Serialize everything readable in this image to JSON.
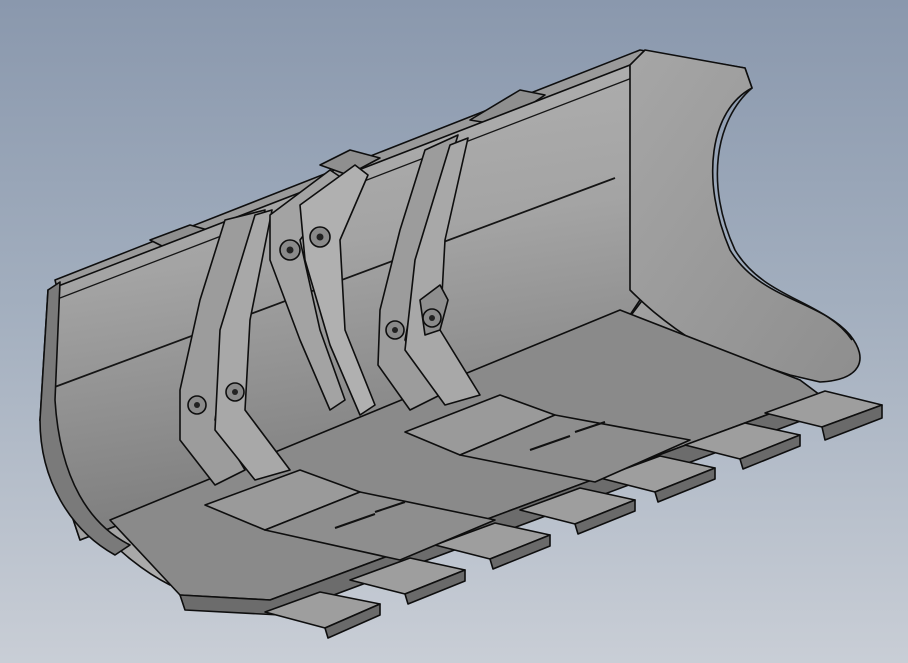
{
  "scene": {
    "subject": "excavator-bucket-cad-model",
    "view": "isometric",
    "background_top": "#8a98ad",
    "background_bottom": "#c9ced6",
    "model_face_light": "#a8a8a8",
    "model_face_mid": "#8c8c8c",
    "model_face_dark": "#6e6e6e",
    "edge_color": "#0e0e0e"
  }
}
